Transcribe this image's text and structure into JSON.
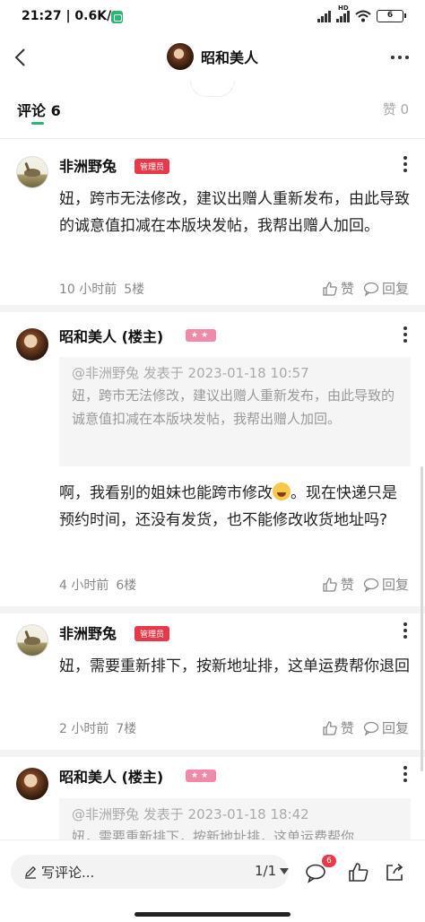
{
  "status_bar": {
    "time": "21:27 | 0.6K/s",
    "network_type": "HD",
    "battery": "6"
  },
  "nav": {
    "title": "昭和美人"
  },
  "tabs": {
    "comments_label": "评论 6",
    "likes_label": "赞 0"
  },
  "comments": [
    {
      "user": "非洲野兔",
      "badge": "管理员",
      "text": "妞，跨市无法修改，建议出赠人重新发布，由此导致的诚意值扣减在本版块发帖，我帮出赠人加回。",
      "time": "10 小时前",
      "floor": "5楼"
    },
    {
      "user": "昭和美人 (楼主)",
      "badge": "★★",
      "quote_head": "@非洲野兔 发表于 2023-01-18 10:57",
      "quote_text": "妞，跨市无法修改，建议出赠人重新发布，由此导致的诚意值扣减在本版块发帖，我帮出赠人加回。",
      "text_before_emoji": "啊，我看别的姐妹也能跨市修改",
      "text_after_emoji": "。现在快递只是预约时间，还没有发货，也不能修改收货地址吗?",
      "time": "4 小时前",
      "floor": "6楼"
    },
    {
      "user": "非洲野兔",
      "badge": "管理员",
      "text": "妞，需要重新排下，按新地址排，这单运费帮你退回",
      "time": "2 小时前",
      "floor": "7楼"
    },
    {
      "user": "昭和美人 (楼主)",
      "badge": "★★",
      "quote_head": "@非洲野兔 发表于 2023-01-18 18:42",
      "quote_text": "妞，需要重新排下，按新地址排，这单运费帮你"
    }
  ],
  "actions": {
    "like_label": "赞",
    "reply_label": "回复"
  },
  "bottom_bar": {
    "write_placeholder": "写评论...",
    "page_indicator": "1/1",
    "comment_count": "6"
  },
  "icons": {
    "back": "back-arrow-icon",
    "more": "more-icon",
    "like": "thumb-up-icon",
    "reply": "chat-bubble-icon",
    "share": "share-icon",
    "edit": "pencil-icon"
  }
}
